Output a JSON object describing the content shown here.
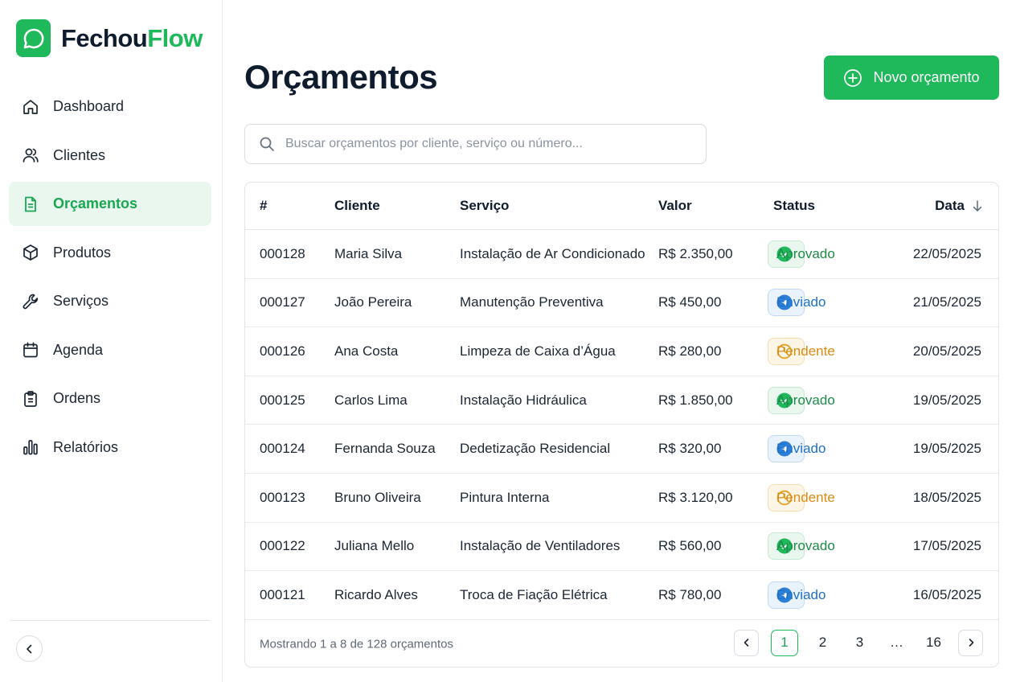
{
  "brand": {
    "name_part1": "Fechou",
    "name_part2": "Flow",
    "color": "#1fb85b"
  },
  "sidebar": {
    "items": [
      {
        "label": "Dashboard",
        "icon": "home-icon"
      },
      {
        "label": "Clientes",
        "icon": "users-icon"
      },
      {
        "label": "Orçamentos",
        "icon": "document-icon",
        "active": true
      },
      {
        "label": "Produtos",
        "icon": "box-icon"
      },
      {
        "label": "Serviços",
        "icon": "wrench-icon"
      },
      {
        "label": "Agenda",
        "icon": "calendar-icon"
      },
      {
        "label": "Ordens",
        "icon": "clipboard-icon"
      },
      {
        "label": "Relatórios",
        "icon": "bar-chart-icon"
      }
    ],
    "collapse_icon": "chevron-left-icon"
  },
  "header": {
    "title": "Orçamentos",
    "new_button_label": "Novo orçamento"
  },
  "search": {
    "placeholder": "Buscar orçamentos por cliente, serviço ou número..."
  },
  "table": {
    "columns": [
      "#",
      "Cliente",
      "Serviço",
      "Valor",
      "Status",
      "Data"
    ],
    "sort_icon": "arrow-down-icon",
    "rows": [
      {
        "num": "000128",
        "cliente": "Maria Silva",
        "servico": "Instalação de Ar Condicionado",
        "valor": "R$ 2.350,00",
        "status": "Aprovado",
        "status_type": "ok",
        "data": "22/05/2025"
      },
      {
        "num": "000127",
        "cliente": "João Pereira",
        "servico": "Manutenção Preventiva",
        "valor": "R$ 450,00",
        "status": "Enviado",
        "status_type": "sent",
        "data": "21/05/2025"
      },
      {
        "num": "000126",
        "cliente": "Ana Costa",
        "servico": "Limpeza de Caixa d’Água",
        "valor": "R$ 280,00",
        "status": "Pendente",
        "status_type": "pend",
        "data": "20/05/2025"
      },
      {
        "num": "000125",
        "cliente": "Carlos Lima",
        "servico": "Instalação Hidráulica",
        "valor": "R$ 1.850,00",
        "status": "Aprovado",
        "status_type": "ok",
        "data": "19/05/2025"
      },
      {
        "num": "000124",
        "cliente": "Fernanda Souza",
        "servico": "Dedetização Residencial",
        "valor": "R$ 320,00",
        "status": "Enviado",
        "status_type": "sent",
        "data": "19/05/2025"
      },
      {
        "num": "000123",
        "cliente": "Bruno Oliveira",
        "servico": "Pintura Interna",
        "valor": "R$ 3.120,00",
        "status": "Pendente",
        "status_type": "pend",
        "data": "18/05/2025"
      },
      {
        "num": "000122",
        "cliente": "Juliana Mello",
        "servico": "Instalação de Ventiladores",
        "valor": "R$ 560,00",
        "status": "Aprovado",
        "status_type": "ok",
        "data": "17/05/2025"
      },
      {
        "num": "000121",
        "cliente": "Ricardo Alves",
        "servico": "Troca de Fiação Elétrica",
        "valor": "R$ 780,00",
        "status": "Enviado",
        "status_type": "sent",
        "data": "16/05/2025"
      }
    ],
    "footer_text": "Mostrando 1 a 8 de 128 orçamentos",
    "pagination": {
      "pages": [
        "1",
        "2",
        "3",
        "…",
        "16"
      ],
      "current": "1"
    }
  },
  "status_colors": {
    "ok": "#1d8a49",
    "sent": "#1f6fc7",
    "pend": "#d98b12"
  }
}
